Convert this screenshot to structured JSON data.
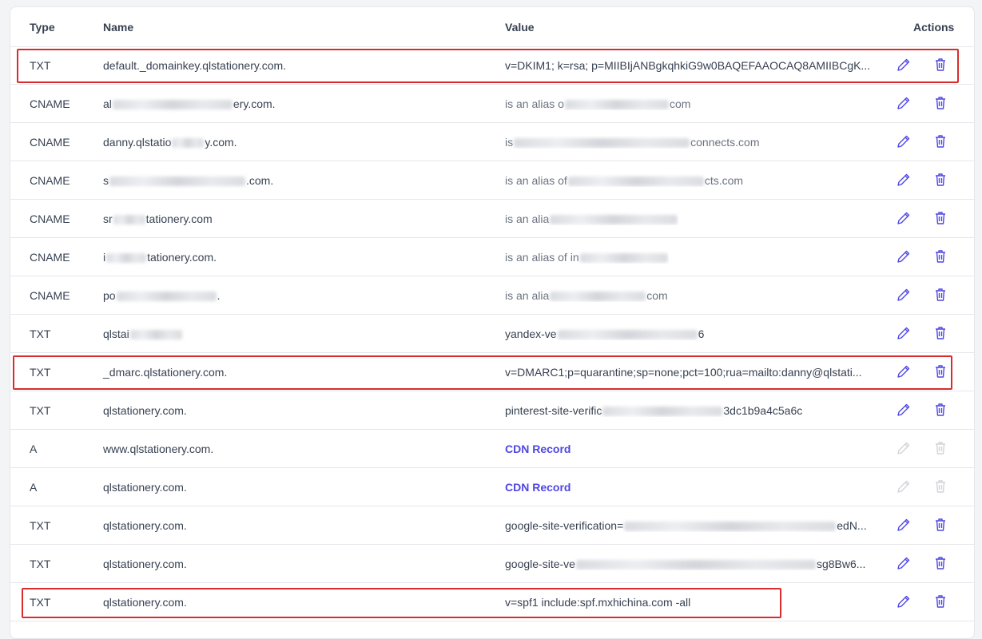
{
  "columns": {
    "type": "Type",
    "name": "Name",
    "value": "Value",
    "actions": "Actions"
  },
  "colors": {
    "accent": "#4f46e5",
    "highlight": "#d92d2d",
    "border": "#e5e7eb"
  },
  "rows": [
    {
      "type": "TXT",
      "name": "default._domainkey.qlstationery.com.",
      "value": "v=DKIM1; k=rsa; p=MIIBIjANBgkqhkiG9w0BAQEFAAOCAQ8AMIIBCgK..."
    },
    {
      "type": "CNAME",
      "name_a": "al",
      "name_b": "ery.com.",
      "value_a": "is an alias o",
      "value_b": "com"
    },
    {
      "type": "CNAME",
      "name_a": "danny.qlstatio",
      "name_b": "y.com.",
      "value_a": "is",
      "value_b": "connects.com"
    },
    {
      "type": "CNAME",
      "name_a": "s",
      "name_b": ".com.",
      "value_a": "is an alias of",
      "value_b": "cts.com"
    },
    {
      "type": "CNAME",
      "name_a": "sr",
      "name_b": "tationery.com",
      "value_a": "is an alia",
      "value_b": ""
    },
    {
      "type": "CNAME",
      "name_a": "i",
      "name_b": "tationery.com.",
      "value_a": "is an alias of in",
      "value_b": ""
    },
    {
      "type": "CNAME",
      "name_a": "po",
      "name_b": ".",
      "value_a": "is an alia",
      "value_b": "com"
    },
    {
      "type": "TXT",
      "name_a": "qlstai",
      "name_b": "",
      "value_a": "yandex-ve",
      "value_b": "6"
    },
    {
      "type": "TXT",
      "name": "_dmarc.qlstationery.com.",
      "value": "v=DMARC1;p=quarantine;sp=none;pct=100;rua=mailto:danny@qlstati..."
    },
    {
      "type": "TXT",
      "name": "qlstationery.com.",
      "value_a": "pinterest-site-verific",
      "value_b": "3dc1b9a4c5a6c"
    },
    {
      "type": "A",
      "name": "www.qlstationery.com.",
      "value": "CDN Record"
    },
    {
      "type": "A",
      "name": "qlstationery.com.",
      "value": "CDN Record"
    },
    {
      "type": "TXT",
      "name": "qlstationery.com.",
      "value_a": "google-site-verification=",
      "value_b": "edN..."
    },
    {
      "type": "TXT",
      "name": "qlstationery.com.",
      "value_a": "google-site-ve",
      "value_b": "sg8Bw6..."
    },
    {
      "type": "TXT",
      "name": "qlstationery.com.",
      "value": "v=spf1 include:spf.mxhichina.com -all"
    }
  ]
}
